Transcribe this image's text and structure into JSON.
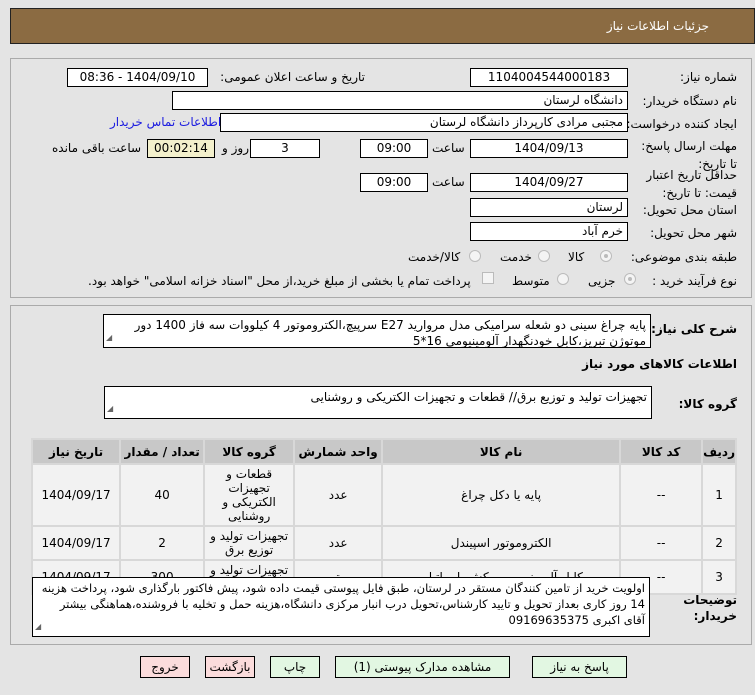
{
  "header": {
    "title": "جزئیات اطلاعات نیاز"
  },
  "form": {
    "need_number_label": "شماره نیاز:",
    "need_number": "1104004544000183",
    "announce_label": "تاریخ و ساعت اعلان عمومی:",
    "announce_value": "1404/09/10 - 08:36",
    "buyer_label": "نام دستگاه خریدار:",
    "buyer_value": "دانشگاه لرستان",
    "creator_label": "ایجاد کننده درخواست:",
    "creator_value": "مجتبی مرادی کارپرداز دانشگاه لرستان",
    "contact_link": "اطلاعات تماس خریدار",
    "deadline_label": "مهلت ارسال پاسخ: تا تاریخ:",
    "deadline_date": "1404/09/13",
    "time_label": "ساعت",
    "deadline_time": "09:00",
    "days": "3",
    "days_label": "روز و",
    "remaining": "00:02:14",
    "remaining_label": "ساعت باقی مانده",
    "validity_label": "حداقل تاریخ اعتبار قیمت: تا تاریخ:",
    "validity_date": "1404/09/27",
    "validity_time": "09:00",
    "province_label": "استان محل تحویل:",
    "province_value": "لرستان",
    "city_label": "شهر محل تحویل:",
    "city_value": "خرم آباد",
    "category_label": "طبقه بندی موضوعی:",
    "category_options": [
      "کالا",
      "خدمت",
      "کالا/خدمت"
    ],
    "process_label": "نوع فرآیند خرید :",
    "process_options": [
      "جزیی",
      "متوسط"
    ],
    "payment_note": "پرداخت تمام یا بخشی از مبلغ خرید،از محل \"اسناد خزانه اسلامی\" خواهد بود."
  },
  "details": {
    "description_label": "شرح کلی نیاز:",
    "description": "پایه چراغ سینی دو شعله سرامیکی مدل مروارید E27 سرپیچ،الکتروموتور 4 کیلووات سه فاز 1400 دور موتوژن تبریز،کابل خودنگهدار آلومینیومی 16*5",
    "goods_heading": "اطلاعات کالاهای مورد نیاز",
    "group_label": "گروه کالا:",
    "group_value": "تجهیزات تولید و توزیع برق// قطعات و تجهیزات الکتریکی و روشنایی",
    "table": {
      "headers": [
        "ردیف",
        "کد کالا",
        "نام کالا",
        "واحد شمارش",
        "گروه کالا",
        "تعداد / مقدار",
        "تاریخ نیاز"
      ],
      "rows": [
        [
          "1",
          "--",
          "پایه یا دکل چراغ",
          "عدد",
          "قطعات و تجهیزات الکتریکی و روشنایی",
          "40",
          "1404/09/17"
        ],
        [
          "2",
          "--",
          "الکتروموتور اسپیندل",
          "عدد",
          "تجهیزات تولید و توزیع برق",
          "2",
          "1404/09/17"
        ],
        [
          "3",
          "--",
          "کابل آلومینیومی روکش پلی اتیلن",
          "متر",
          "تجهیزات تولید و توزیع برق",
          "300",
          "1404/09/17"
        ]
      ]
    },
    "notes_label": "توضیحات خریدار:",
    "notes": "اولویت خرید از تامین کنندگان مستقر در لرستان، طبق فایل پیوستی قیمت داده شود، پیش فاکتور بارگذاری شود، پرداخت هزینه 14 روز کاری بعداز تحویل و تایید کارشناس،تحویل درب انبار مرکزی دانشگاه،هزینه حمل و تخلیه با فروشنده،هماهنگی بیشتر آقای اکبری 09169635375"
  },
  "buttons": {
    "reply": "پاسخ به نیاز",
    "attachments": "مشاهده مدارک پیوستی (1)",
    "print": "چاپ",
    "back": "بازگشت",
    "exit": "خروج"
  }
}
